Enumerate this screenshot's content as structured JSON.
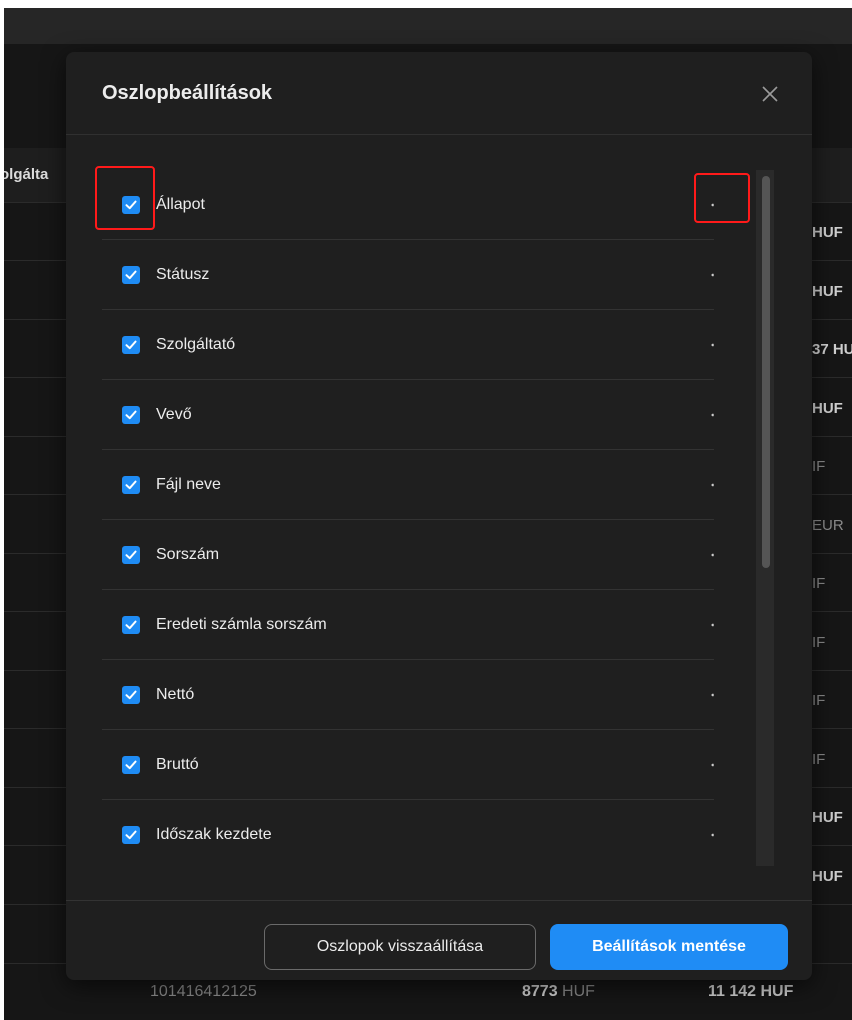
{
  "background": {
    "header_fragment": "olgálta",
    "right_values": [
      {
        "text": "HUF",
        "dim": false
      },
      {
        "text": "HUF",
        "dim": false
      },
      {
        "text": "37 HU",
        "dim": false
      },
      {
        "text": "HUF",
        "dim": false
      },
      {
        "text": "IF",
        "dim": true
      },
      {
        "text": "EUR",
        "dim": true
      },
      {
        "text": "IF",
        "dim": true
      },
      {
        "text": "IF",
        "dim": true
      },
      {
        "text": "IF",
        "dim": true
      },
      {
        "text": "IF",
        "dim": true
      },
      {
        "text": "HUF",
        "dim": false
      },
      {
        "text": "HUF",
        "dim": false
      }
    ],
    "bottom_row": {
      "id": "101416412125",
      "net_amount": "8773",
      "net_currency": "HUF",
      "gross": "11 142 HUF"
    }
  },
  "modal": {
    "title": "Oszlopbeállítások",
    "close_icon": "close-icon",
    "columns": [
      {
        "label": "Állapot",
        "checked": true
      },
      {
        "label": "Státusz",
        "checked": true
      },
      {
        "label": "Szolgáltató",
        "checked": true
      },
      {
        "label": "Vevő",
        "checked": true
      },
      {
        "label": "Fájl neve",
        "checked": true
      },
      {
        "label": "Sorszám",
        "checked": true
      },
      {
        "label": "Eredeti számla sorszám",
        "checked": true
      },
      {
        "label": "Nettó",
        "checked": true
      },
      {
        "label": "Bruttó",
        "checked": true
      },
      {
        "label": "Időszak kezdete",
        "checked": true
      }
    ],
    "reset_button": "Oszlopok visszaállítása",
    "save_button": "Beállítások mentése"
  },
  "colors": {
    "accent": "#1f8cf5",
    "highlight": "#ff1a1a"
  }
}
